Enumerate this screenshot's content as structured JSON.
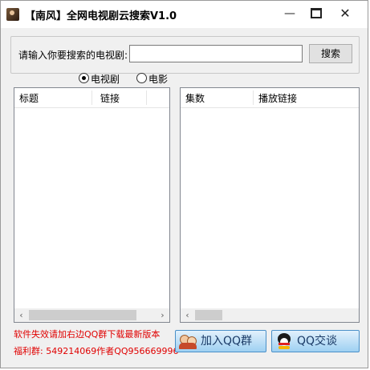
{
  "window": {
    "title": "【南风】全网电视剧云搜索V1.0",
    "controls": {
      "minimize": "—",
      "close": "✕"
    }
  },
  "search": {
    "label": "请输入你要搜索的电视剧:",
    "value": "",
    "button": "搜索"
  },
  "mode": {
    "options": [
      {
        "label": "电视剧",
        "checked": true
      },
      {
        "label": "电影",
        "checked": false
      }
    ]
  },
  "left_list": {
    "columns": [
      "标题",
      "链接"
    ]
  },
  "right_list": {
    "columns": [
      "集数",
      "播放链接"
    ]
  },
  "footer": {
    "notice_line1": "软件失效请加右边QQ群下载最新版本",
    "notice_line2": "福利群: 549214069作者QQ956669996",
    "join_group_button": "加入QQ群",
    "qq_chat_button": "QQ交谈"
  },
  "scroll_arrows": {
    "left": "‹",
    "right": "›"
  },
  "colors": {
    "notice": "#e00000",
    "button_gradient_top": "#e2f1fc",
    "button_gradient_bottom": "#9ed0f2"
  }
}
